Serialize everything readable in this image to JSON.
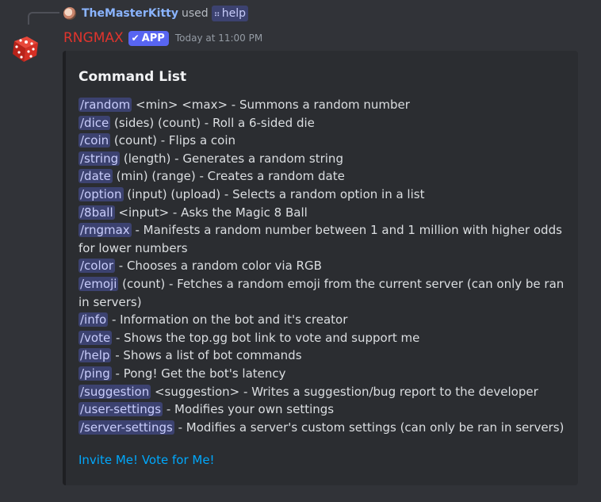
{
  "reply": {
    "user": "TheMasterKitty",
    "used": "used",
    "command": "help"
  },
  "message": {
    "bot_name": "RNGMAX",
    "badge": "APP",
    "timestamp": "Today at 11:00 PM"
  },
  "embed": {
    "title": "Command List",
    "commands": [
      {
        "name": "/random",
        "text": " <min> <max> - Summons a random number"
      },
      {
        "name": "/dice",
        "text": " (sides) (count) - Roll a 6-sided die"
      },
      {
        "name": "/coin",
        "text": " (count) - Flips a coin"
      },
      {
        "name": "/string",
        "text": " (length) - Generates a random string"
      },
      {
        "name": "/date",
        "text": " (min) (range) - Creates a random date"
      },
      {
        "name": "/option",
        "text": " (input) (upload) - Selects a random option in a list"
      },
      {
        "name": "/8ball",
        "text": " <input> - Asks the Magic 8 Ball"
      },
      {
        "name": "/rngmax",
        "text": " - Manifests a random number between 1 and 1 million with higher odds for lower numbers"
      },
      {
        "name": "/color",
        "text": " - Chooses a random color via RGB"
      },
      {
        "name": "/emoji",
        "text": " (count) - Fetches a random emoji from the current server (can only be ran in servers)"
      },
      {
        "name": "/info",
        "text": " - Information on the bot and it's creator"
      },
      {
        "name": "/vote",
        "text": " - Shows the top.gg bot link to vote and support me"
      },
      {
        "name": "/help",
        "text": " - Shows a list of bot commands"
      },
      {
        "name": "/ping",
        "text": " - Pong! Get the bot's latency"
      },
      {
        "name": "/suggestion",
        "text": " <suggestion> - Writes a suggestion/bug report to the developer"
      },
      {
        "name": "/user-settings",
        "text": " - Modifies your own settings"
      },
      {
        "name": "/server-settings",
        "text": " - Modifies a server's custom settings (can only be ran in servers)"
      }
    ],
    "invite_link": "Invite Me!",
    "vote_link": "Vote for Me!"
  },
  "icons": {
    "avatar": "red-dice-icon",
    "reply_avatar": "user-avatar",
    "slash": "slash-command-icon",
    "badge_check": "check-icon"
  },
  "colors": {
    "background": "#313338",
    "embed_bg": "#2b2d31",
    "bot_name": "#e0342d",
    "badge": "#5865f2",
    "link": "#00a8fc",
    "chip_bg": "#3c4270",
    "chip_text": "#c9cdfb"
  }
}
